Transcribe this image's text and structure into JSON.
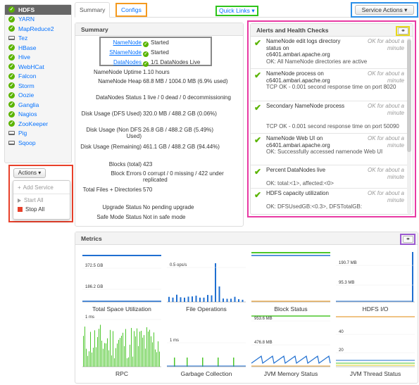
{
  "sidebar": {
    "items": [
      {
        "label": "HDFS",
        "icon": "ok-icon",
        "active": true
      },
      {
        "label": "YARN",
        "icon": "ok-icon"
      },
      {
        "label": "MapReduce2",
        "icon": "ok-icon"
      },
      {
        "label": "Tez",
        "icon": "client-icon"
      },
      {
        "label": "HBase",
        "icon": "ok-icon"
      },
      {
        "label": "Hive",
        "icon": "ok-icon"
      },
      {
        "label": "WebHCat",
        "icon": "ok-icon"
      },
      {
        "label": "Falcon",
        "icon": "ok-icon"
      },
      {
        "label": "Storm",
        "icon": "ok-icon"
      },
      {
        "label": "Oozie",
        "icon": "ok-icon"
      },
      {
        "label": "Ganglia",
        "icon": "ok-icon"
      },
      {
        "label": "Nagios",
        "icon": "ok-icon"
      },
      {
        "label": "ZooKeeper",
        "icon": "ok-icon"
      },
      {
        "label": "Pig",
        "icon": "client-icon"
      },
      {
        "label": "Sqoop",
        "icon": "client-icon"
      }
    ],
    "actions_label": "Actions",
    "actions_menu": {
      "add_service": "Add Service",
      "start_all": "Start All",
      "stop_all": "Stop All"
    }
  },
  "tabs": {
    "summary": "Summary",
    "configs": "Configs"
  },
  "quick_links": "Quick Links",
  "service_actions": "Service Actions",
  "summary": {
    "title": "Summary",
    "components": [
      {
        "name": "NameNode",
        "status": "Started"
      },
      {
        "name": "SNameNode",
        "status": "Started"
      },
      {
        "name": "DataNodes",
        "status": "1/1 DataNodes Live"
      }
    ],
    "rows": [
      {
        "key": "NameNode Uptime",
        "value": "1.10 hours"
      },
      {
        "key": "NameNode Heap",
        "value": "68.8 MB / 1004.0 MB (6.9% used)"
      },
      {
        "key": "DataNodes Status",
        "value": "1 live / 0 dead / 0 decommissioning"
      },
      {
        "key": "Disk Usage (DFS Used)",
        "value": "320.0 MB / 488.2 GB (0.06%)"
      },
      {
        "key": "Disk Usage (Non DFS Used)",
        "value": "26.8 GB / 488.2 GB (5.49%)"
      },
      {
        "key": "Disk Usage (Remaining)",
        "value": "461.1 GB / 488.2 GB (94.44%)"
      },
      {
        "key": "Blocks (total)",
        "value": "423"
      },
      {
        "key": "Block Errors",
        "value": "0 corrupt / 0 missing / 422 under replicated"
      },
      {
        "key": "Total Files + Directories",
        "value": "570"
      },
      {
        "key": "Upgrade Status",
        "value": "No pending upgrade"
      },
      {
        "key": "Safe Mode Status",
        "value": "Not in safe mode"
      }
    ]
  },
  "alerts": {
    "title": "Alerts and Health Checks",
    "items": [
      {
        "title": "NameNode edit logs directory status on c6401.ambari.apache.org",
        "time": "OK for about a minute",
        "desc": "OK: All NameNode directories are active"
      },
      {
        "title": "NameNode process on c6401.ambari.apache.org",
        "time": "OK for about a minute",
        "desc": "TCP OK - 0.001 second response time on port 8020"
      },
      {
        "title": "Secondary NameNode process",
        "time": "OK for about a minute",
        "desc": "TCP OK - 0.001 second response time on port 50090"
      },
      {
        "title": "NameNode Web UI on c6401.ambari.apache.org",
        "time": "OK for about a minute",
        "desc": "OK: Successfully accessed namenode Web UI"
      },
      {
        "title": "Percent DataNodes live",
        "time": "OK for about a minute",
        "desc": "OK: total:<1>, affected:<0>"
      },
      {
        "title": "HDFS capacity utilization",
        "time": "OK for about a minute",
        "desc": "OK: DFSUsedGB:<0.3>, DFSTotalGB:"
      }
    ]
  },
  "metrics": {
    "title": "Metrics",
    "charts": [
      {
        "label": "Total Space Utilization",
        "y_ticks": [
          "372.5 GB",
          "186.2 GB"
        ]
      },
      {
        "label": "File Operations",
        "y_ticks": [
          "0.5 ops/s"
        ]
      },
      {
        "label": "Block Status",
        "y_ticks": []
      },
      {
        "label": "HDFS I/O",
        "y_ticks": [
          "190.7 MB",
          "95.3 MB"
        ]
      },
      {
        "label": "RPC",
        "y_ticks": [
          "1 ms"
        ]
      },
      {
        "label": "Garbage Collection",
        "y_ticks": [
          "1 ms"
        ]
      },
      {
        "label": "JVM Memory Status",
        "y_ticks": [
          "953.6 MB",
          "476.8 MB"
        ]
      },
      {
        "label": "JVM Thread Status",
        "y_ticks": [
          "40",
          "20"
        ]
      }
    ]
  },
  "colors": {
    "link": "#0572ff",
    "ok_green": "#5ab400",
    "chart_blue": "#1f6fd1",
    "chart_green": "#4bc62a",
    "chart_orange": "#e8a13a",
    "actions_border": "#e8402a",
    "configs_border": "#f49a1f",
    "quicklinks_border": "#2fc41b",
    "service_actions_border": "#2b8fe8",
    "alerts_border": "#e83aa4",
    "metrics_gear_border": "#9b59d0"
  }
}
